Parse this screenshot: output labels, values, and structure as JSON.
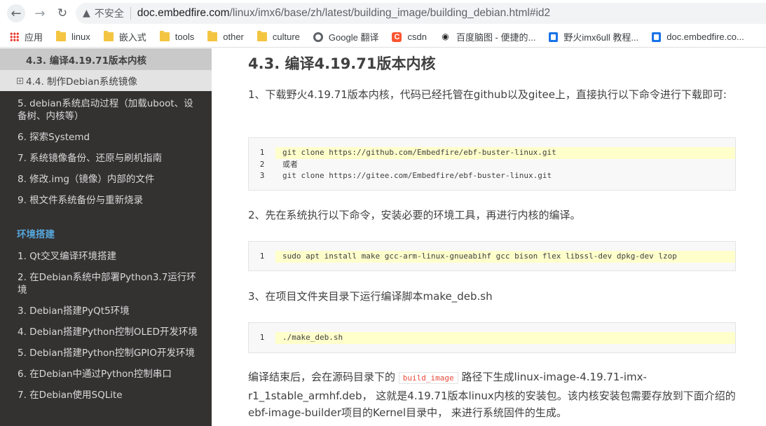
{
  "browser": {
    "security_label": "不安全",
    "url_host": "doc.embedfire.com",
    "url_path": "/linux/imx6/base/zh/latest/building_image/building_debian.html#id2",
    "bookmarks": [
      "应用",
      "linux",
      "嵌入式",
      "tools",
      "other",
      "culture",
      "Google 翻译",
      "csdn",
      "百度脑图 - 便捷的...",
      "野火imx6ull 教程...",
      "doc.embedfire.co..."
    ]
  },
  "sidebar": {
    "current": "4.3. 编译4.19.71版本内核",
    "sub": "4.4. 制作Debian系统镜像",
    "items_a": [
      "5. debian系统启动过程（加载uboot、设备树、内核等）",
      "6. 探索Systemd",
      "7. 系统镜像备份、还原与刷机指南",
      "8. 修改.img（镜像）内部的文件",
      "9. 根文件系统备份与重新烧录"
    ],
    "caption": "环境搭建",
    "items_b": [
      "1. Qt交叉编译环境搭建",
      "2. 在Debian系统中部署Python3.7运行环境",
      "3. Debian搭建PyQt5环境",
      "4. Debian搭建Python控制OLED开发环境",
      "5. Debian搭建Python控制GPIO开发环境",
      "6. 在Debian中通过Python控制串口",
      "7. 在Debian使用SQLite"
    ]
  },
  "content": {
    "title": "4.3. 编译4.19.71版本内核",
    "step1": "1、下载野火4.19.71版本内核，代码已经托管在github以及gitee上，直接执行以下命令进行下载即可:",
    "code1": {
      "lines": [
        "1",
        "2",
        "3"
      ],
      "code": [
        "git clone https://github.com/Embedfire/ebf-buster-linux.git",
        "或者",
        "git clone https://gitee.com/Embedfire/ebf-buster-linux.git"
      ]
    },
    "step2": "2、先在系统执行以下命令，安装必要的环境工具，再进行内核的编译。",
    "code2": {
      "line": "1",
      "code": "sudo apt install make gcc-arm-linux-gnueabihf gcc bison flex libssl-dev dpkg-dev lzop"
    },
    "step3": "3、在项目文件夹目录下运行编译脚本make_deb.sh",
    "code3": {
      "line": "1",
      "code": "./make_deb.sh"
    },
    "final_before": "编译结束后，会在源码目录下的",
    "final_code": "build_image",
    "final_after": "路径下生成linux-image-4.19.71-imx-r1_1stable_armhf.deb， 这就是4.19.71版本linux内核的安装包。该内核安装包需要存放到下面介绍的ebf-image-builder项目的Kernel目录中， 来进行系统固件的生成。"
  }
}
